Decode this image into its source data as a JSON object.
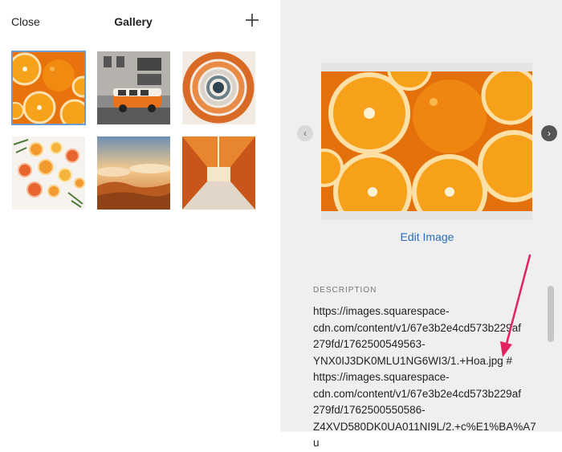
{
  "header": {
    "close_label": "Close",
    "title": "Gallery",
    "add_icon": "plus-icon"
  },
  "gallery": {
    "thumbnails": [
      {
        "subject": "orange halves",
        "selected": true
      },
      {
        "subject": "orange van on street",
        "selected": false
      },
      {
        "subject": "spiral staircase",
        "selected": false
      },
      {
        "subject": "citrus slices with herbs",
        "selected": false
      },
      {
        "subject": "clouds at sunset",
        "selected": false
      },
      {
        "subject": "orange tunnel",
        "selected": false
      }
    ]
  },
  "preview": {
    "prev_icon": "chevron-left-icon",
    "next_icon": "chevron-right-icon",
    "edit_label": "Edit Image"
  },
  "description": {
    "label": "DESCRIPTION",
    "lines": [
      "https://images.squarespace-",
      "cdn.com/content/v1/67e3b2e4cd573b229af",
      "279fd/1762500549563-",
      "YNX0IJ3DK0MLU1NG6WI3/1.+Hoa.jpg #",
      "https://images.squarespace-",
      "cdn.com/content/v1/67e3b2e4cd573b229af",
      "279fd/1762500550586-",
      "Z4XVD580DK0UA011NI9L/2.+c%E1%BA%A7u"
    ]
  },
  "colors": {
    "accent_link": "#2a6ebd",
    "selected_outline": "#6b9bd1",
    "annotation_arrow": "#e0245e"
  }
}
